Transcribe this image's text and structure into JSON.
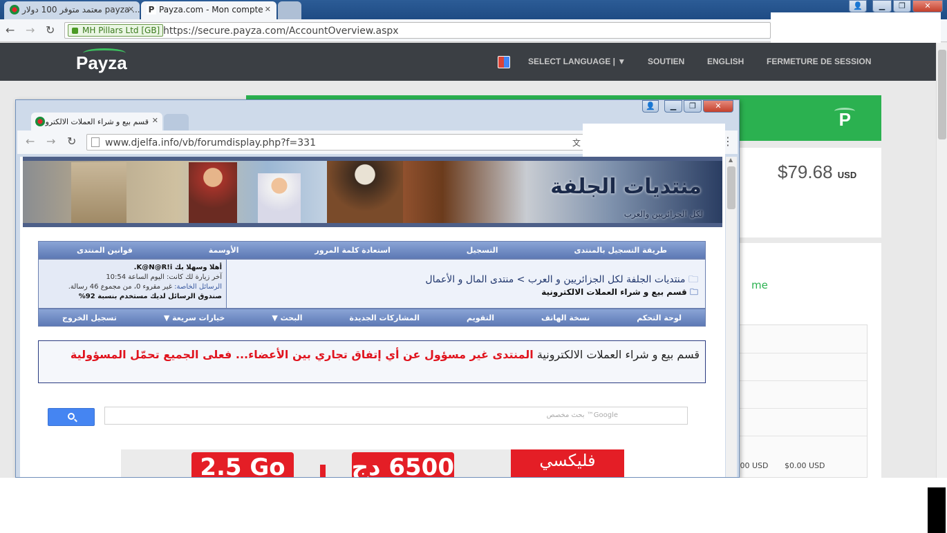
{
  "outer_tabs": [
    {
      "title": "معتمد متوفر 100 دولار payza ..."
    },
    {
      "title": "Payza.com - Mon compte"
    }
  ],
  "outer_address": {
    "ev_label": "MH Pillars Ltd [GB]",
    "url": "https://secure.payza.com/AccountOverview.aspx"
  },
  "payza": {
    "logo": "Payza",
    "nav": [
      "SELECT LANGUAGE | ▼",
      "SOUTIEN",
      "ENGLISH",
      "FERMETURE DE SESSION"
    ],
    "balance": "$79.68",
    "currency": "USD",
    "partial_text": "me",
    "usd_values": [
      ".00 USD",
      "$0.00 USD"
    ],
    "brand_green": "#2bb150"
  },
  "inner_browser": {
    "tab_title": "قسم بيع و شراء العملات الالكترونية",
    "url": "www.djelfa.info/vb/forumdisplay.php?f=331"
  },
  "forum": {
    "banner_title": "منتديات الجلفة",
    "banner_subtitle": "لكل الجزائريين والعرب",
    "top_nav": [
      "طريقة التسجيل بالمنتدى",
      "التسجيل",
      "استعادة كلمة المرور",
      "الأوسمة",
      "قوانين المنتدى"
    ],
    "breadcrumb": "منتديات الجلفة لكل الجزائريين و العرب > منتدى المال و الأعمال",
    "current_forum": "قسم بيع و شراء العملات الالكترونية",
    "welcome": {
      "greeting": "أهلا وسهلا بك K@N@R!i.",
      "last_visit": "آخر زيارة لك كانت: اليوم الساعة 10:54",
      "pm_label": "الرسائل الخاصة:",
      "pm_text": "غير مقروء 0، من مجموع 46 رسالة.",
      "quota": "صندوق الرسائل لديك مستخدم بنسبة 92%"
    },
    "user_nav": [
      "لوحة التحكم",
      "نسخة الهاتف",
      "التقويم",
      "المشاركات الجديدة",
      "البحث ▼",
      "خيارات سريعة ▼",
      "تسجيل الخروج"
    ],
    "notice_normal": "قسم بيع و شراء العملات الالكترونية",
    "notice_red": "المنتدى غير مسؤول عن أي إتفاق تجاري بين الأعضاء... فعلى الجميع تحمّل المسؤولية",
    "search_placeholder": "Google™ بحث مخصص",
    "ad": {
      "left": "2.5 Go",
      "mid": "6500 دج",
      "right": "فليكسي"
    }
  }
}
